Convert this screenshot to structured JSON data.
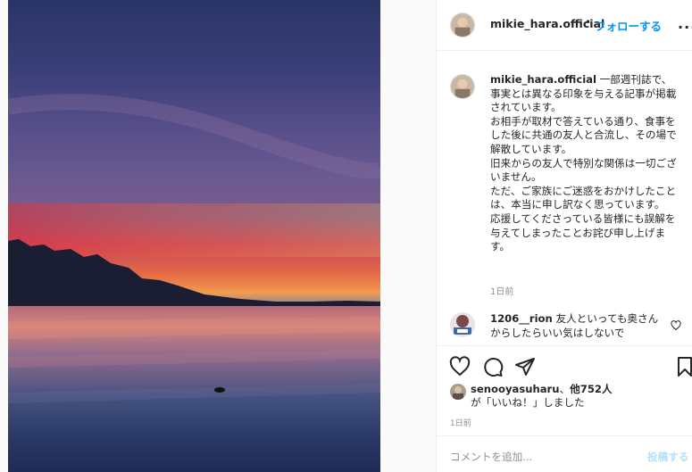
{
  "photo": {
    "alt_icon": "sunset-lake-photo"
  },
  "header": {
    "username": "mikie_hara.official",
    "dot": "•",
    "follow_label": "フォローする",
    "more_label": "..."
  },
  "caption": {
    "username": "mikie_hara.official",
    "text": " 一部週刊誌で、事実とは異なる印象を与える記事が掲載されています。\nお相手が取材で答えている通り、食事をした後に共通の友人と合流し、その場で解散しています。\n旧来からの友人で特別な関係は一切ございません。\nただ、ご家族にご迷惑をおかけしたことは、本当に申し訳なく思っています。\n応援してくださっている皆様にも誤解を与えてしまったことお詫び申し上げます。",
    "time": "1日前"
  },
  "comment": {
    "username": "1206__rion",
    "text": " 友人といっても奥さんからしたらいい気はしないで"
  },
  "actions": {
    "like_icon": "heart-icon",
    "comment_icon": "comment-icon",
    "share_icon": "paper-plane-icon",
    "save_icon": "bookmark-icon"
  },
  "likes": {
    "user": "senooyasuharu",
    "sep": "、",
    "others": "他752人",
    "line2": "が「いいね！」しました"
  },
  "post_time": "1日前",
  "add_comment": {
    "placeholder": "コメントを追加...",
    "post_label": "投稿する"
  }
}
